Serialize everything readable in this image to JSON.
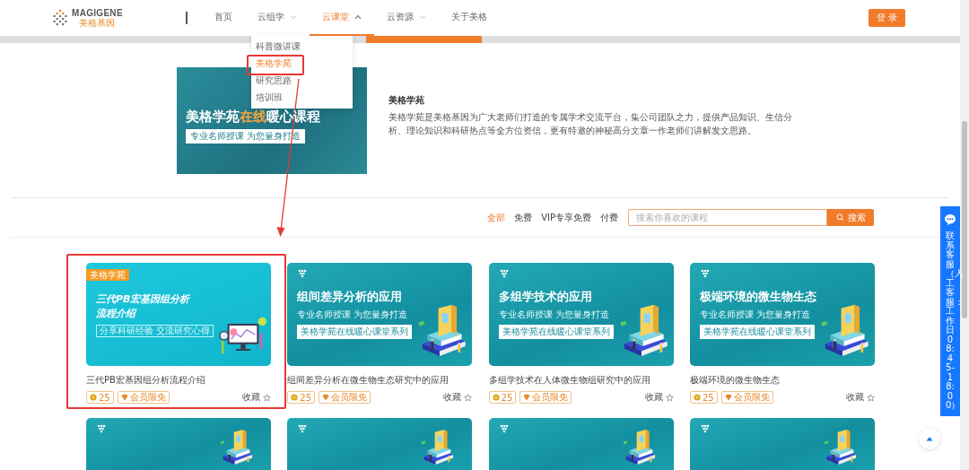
{
  "header": {
    "logo": {
      "name": "MAGIGENE",
      "subtitle": "美格基因"
    },
    "nav": [
      {
        "label": "首页",
        "caret": false,
        "selected": false
      },
      {
        "label": "云组学",
        "caret": true,
        "expanded": false,
        "selected": false
      },
      {
        "label": "云课堂",
        "caret": true,
        "expanded": true,
        "selected": true
      },
      {
        "label": "云资源",
        "caret": true,
        "expanded": false,
        "selected": false
      },
      {
        "label": "关于美格",
        "caret": false,
        "selected": false
      }
    ],
    "login": "登 录"
  },
  "dropdown": [
    {
      "label": "科普微讲课",
      "selected": false
    },
    {
      "label": "美格学苑",
      "selected": true
    },
    {
      "label": "研究思路",
      "selected": false
    },
    {
      "label": "培训班",
      "selected": false
    }
  ],
  "hero": {
    "banner": {
      "title": "美格学苑",
      "highlight": "在线",
      "title_end": "暖心课程",
      "subtitle": "专业名师授课  为您量身打造"
    },
    "heading": "美格学苑",
    "description": "美格学苑是美格基因为广大老师们打造的专属学术交流平台，集公司团队之力，提供产品知识、生信分析、理论知识和科研热点等全方位资信，更有特邀的神秘高分文章一作老师们讲解发文思路。"
  },
  "filters": [
    {
      "label": "全部",
      "selected": true
    },
    {
      "label": "免费",
      "selected": false
    },
    {
      "label": "VIP专享免费",
      "selected": false
    },
    {
      "label": "付费",
      "selected": false
    }
  ],
  "search": {
    "placeholder": "搜索你喜欢的课程",
    "button": "搜索"
  },
  "courses": [
    {
      "kind": "illustrated",
      "banner_tag": "美格学苑",
      "banner_title": "三代PB宏基因组分析流程介绍",
      "banner_subtitle": "分享科研经验  交流研究心得",
      "title": "三代PB宏基因组分析流程介绍",
      "coins": "25",
      "member": "会员限免",
      "favorite": "收藏"
    },
    {
      "kind": "books",
      "banner_title": "组间差异分析的应用",
      "banner_subtitle": "专业名师授课  为您量身打造",
      "banner_badge": "美格学苑在线暖心课堂系列",
      "title": "组间差异分析在微生物生态研究中的应用",
      "coins": "25",
      "member": "会员限免",
      "favorite": "收藏"
    },
    {
      "kind": "books",
      "banner_title": "多组学技术的应用",
      "banner_subtitle": "专业名师授课  为您量身打造",
      "banner_badge": "美格学苑在线暖心课堂系列",
      "title": "多组学技术在人体微生物组研究中的应用",
      "coins": "25",
      "member": "会员限免",
      "favorite": "收藏"
    },
    {
      "kind": "books",
      "banner_title": "极端环境的微生物生态",
      "banner_subtitle": "专业名师授课  为您量身打造",
      "banner_badge": "美格学苑在线暖心课堂系列",
      "title": "极端环境的微生物生态",
      "coins": "25",
      "member": "会员限免",
      "favorite": "收藏"
    },
    {
      "kind": "books"
    },
    {
      "kind": "books"
    },
    {
      "kind": "books"
    },
    {
      "kind": "books"
    }
  ],
  "service": {
    "label": "联系客服（人工客服：工作日 08:45-18:00）"
  }
}
